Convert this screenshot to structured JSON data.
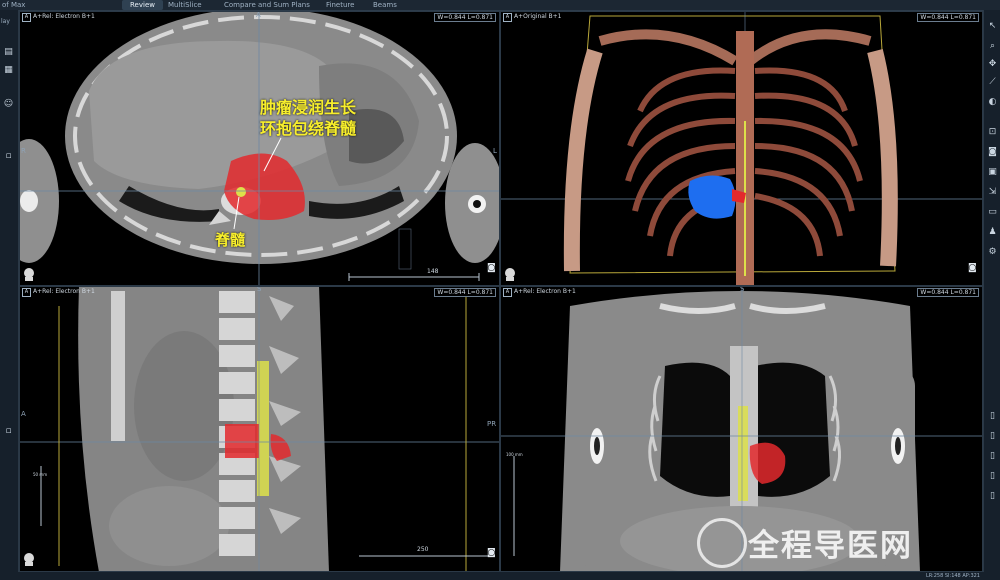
{
  "app": {
    "title": "of Max"
  },
  "tabs": [
    {
      "label": "Review",
      "active": true
    },
    {
      "label": "MultiSlice",
      "active": false
    },
    {
      "label": "Compare and Sum Plans",
      "active": false
    },
    {
      "label": "Fineture",
      "active": false
    },
    {
      "label": "Beams",
      "active": false
    }
  ],
  "left_toolbar": {
    "top_label": "lay"
  },
  "viewports": {
    "axial": {
      "label": "A+Rel: Electron B+1",
      "wl": "W=0.844 L=0.871",
      "orient_top": "A",
      "orient_left": "R",
      "orient_right": "L",
      "scale_value": "148"
    },
    "render3d": {
      "label": "A+Original B+1",
      "wl": "W=0.844 L=0.871"
    },
    "sagittal": {
      "label": "A+Rel: Electron B+1",
      "wl": "W=0.844 L=0.871",
      "orient_top": "S",
      "orient_left": "A",
      "orient_right": "PR",
      "scale_value": "250",
      "ruler": "50 mm"
    },
    "coronal": {
      "label": "A+Rel: Electron B+1",
      "wl": "W=0.844 L=0.871",
      "orient_top": "S",
      "ruler": "100 mm"
    }
  },
  "annotations": {
    "tumor_line1": "肿瘤浸润生长",
    "tumor_line2": "环抱包绕脊髓",
    "spinal_cord": "脊髓"
  },
  "watermark": "全程导医网",
  "status": "LR:258 SI:148 AP:321",
  "colors": {
    "tumor": "#e3292d",
    "cord": "#dde04a",
    "tumor3d": "#1e6ef0",
    "annotation": "#f7ee2c"
  }
}
